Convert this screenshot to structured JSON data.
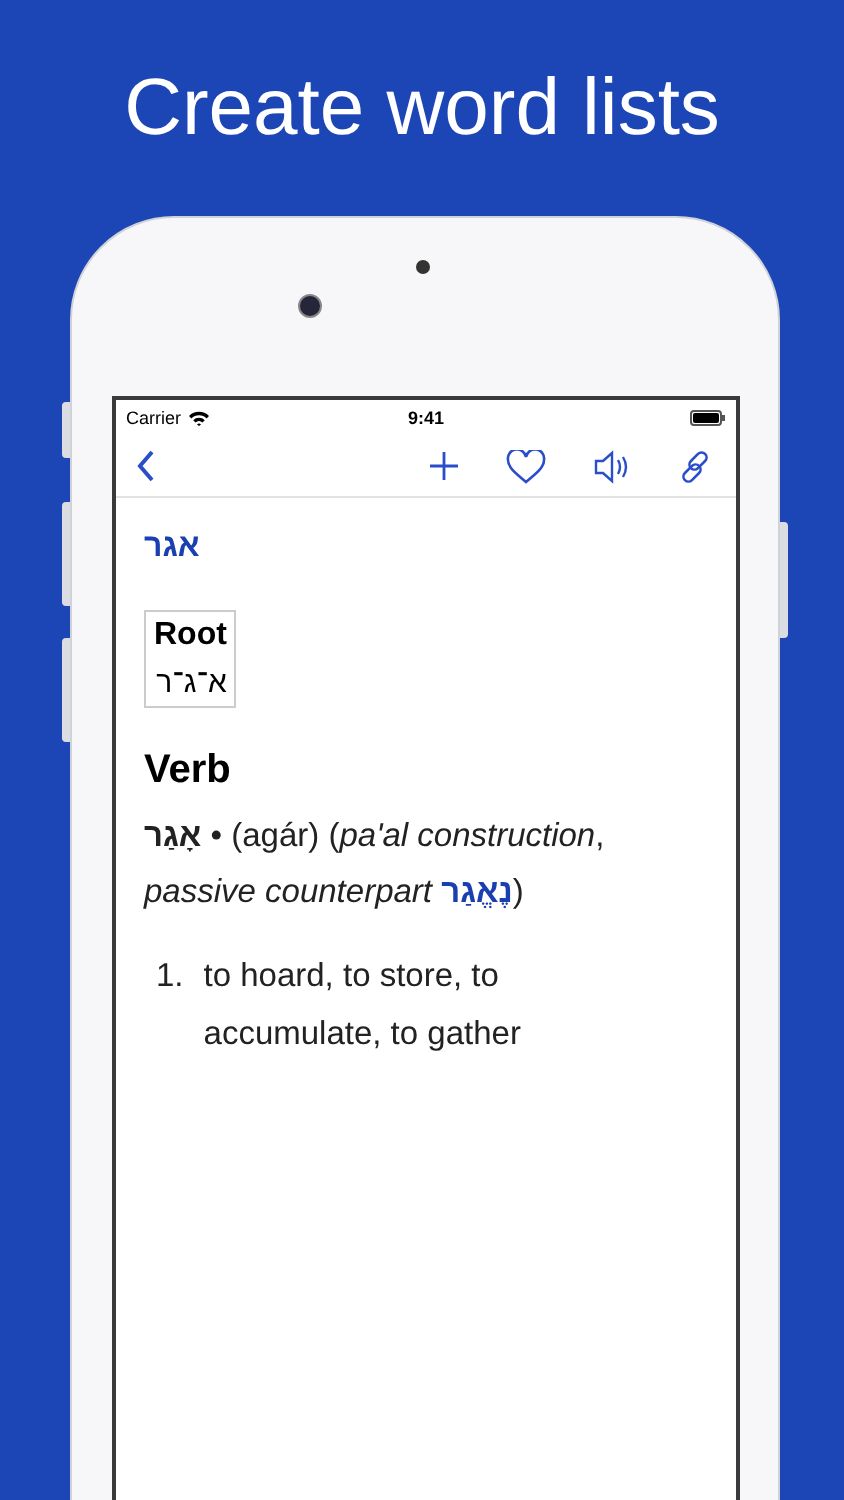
{
  "headline": "Create word lists",
  "status_bar": {
    "carrier": "Carrier",
    "time": "9:41"
  },
  "nav_bar": {
    "actions": [
      {
        "kind": "add"
      },
      {
        "kind": "favorite"
      },
      {
        "kind": "speak"
      },
      {
        "kind": "link"
      }
    ]
  },
  "entry": {
    "headword": "אגר",
    "root": {
      "label": "Root",
      "letters": "א־ג־ר"
    },
    "part_of_speech": "Verb",
    "form": "אָגַר",
    "line_before": "• (agár) (*pa'al construction*, *passive counterpart* ",
    "link": "נֶאֱגַר",
    "line_after": ")",
    "definitions": [
      {
        "number": "1.",
        "text": "to hoard, to store, to accumulate, to gather"
      }
    ]
  }
}
